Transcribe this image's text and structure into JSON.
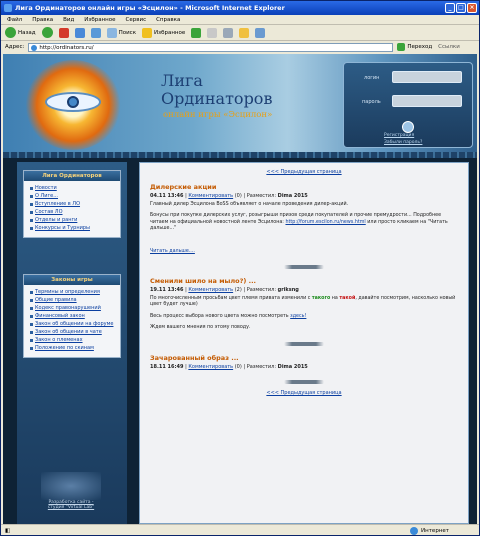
{
  "window": {
    "title": "Лига Ординаторов онлайн игры «Эсцилон» - Microsoft Internet Explorer"
  },
  "menu": [
    "Файл",
    "Правка",
    "Вид",
    "Избранное",
    "Сервис",
    "Справка"
  ],
  "toolbar": {
    "back": "Назад",
    "search": "Поиск",
    "favorites": "Избранное"
  },
  "address": {
    "label": "Адрес:",
    "url": "http://ordinators.ru/",
    "go": "Переход",
    "links": "Ссылки"
  },
  "status": {
    "zone": "Интернет"
  },
  "header": {
    "logo_line1": "Лига",
    "logo_line2": "Ординаторов",
    "logo_line3": "онлайн игры «Эсцилон»",
    "login_label": "логин",
    "password_label": "пароль",
    "register": "Регистрация",
    "forgot": "Забыли пароль?"
  },
  "sidebar": {
    "panel1": {
      "title": "Лига Ординаторов",
      "items": [
        "Новости",
        "О Лиге...",
        "Вступление в ЛО",
        "Состав ЛО",
        "Отделы и ранги",
        "Конкурсы и Турниры"
      ]
    },
    "panel2": {
      "title": "Законы игры",
      "items": [
        "Термины и определения",
        "Общие правила",
        "Кодекс правонарушений",
        "Финансовый закон",
        "Закон об общении на форуме",
        "Закон об общении в чате",
        "Закон о племенах",
        "Положение по скинам"
      ]
    },
    "footer1": "Разработка сайта -",
    "footer2": "студия \"Virtual Lab\""
  },
  "main": {
    "prev_top": "<<< Предыдущая страница",
    "prev_bottom": "<<< Предыдущая страница",
    "posts": [
      {
        "title": "Дилерские акции",
        "date": "04.11 13:46",
        "comment": "Комментировать",
        "count": "(0)",
        "author_label": "Разместил:",
        "author": "Dima 2015",
        "body": "Главный дилер Эсцилона BoSS объявляет о начале проведения дилер-акций.",
        "body2": "Бонусы при покупке дилерских услуг, розыгрыши призов среди покупателей и прочие премудрости... Подробнее читаем на официальной новостной ленте Эсцилона:",
        "link": "http://forum.escilon.ru/news.html",
        "body3": "или просто кликаем на \"Читать дальше...\"",
        "more": "Читать дальше...."
      },
      {
        "title": "Сменили шило на мыло?) ...",
        "date": "19.11 13:46",
        "comment": "Комментировать",
        "count": "(2)",
        "author_label": "Разместил:",
        "author": "griksng",
        "body_a": "По многочисленным просьбам цвет племя привата изменили с",
        "word_green": "такого",
        "mid": "на",
        "word_red": "такой",
        "body_b": ", давайте посмотрим, насколько новый цвет будет лучше)",
        "body2": "Весь процесс выбора нового цвета можно посмотреть",
        "link": "здесь!",
        "body3": "Ждем вашего мнения по этому поводу."
      },
      {
        "title": "Зачарованный образ ...",
        "date": "18.11 16:49",
        "comment": "Комментировать",
        "count": "(0)",
        "author_label": "Разместил:",
        "author": "Dima 2015"
      }
    ]
  }
}
